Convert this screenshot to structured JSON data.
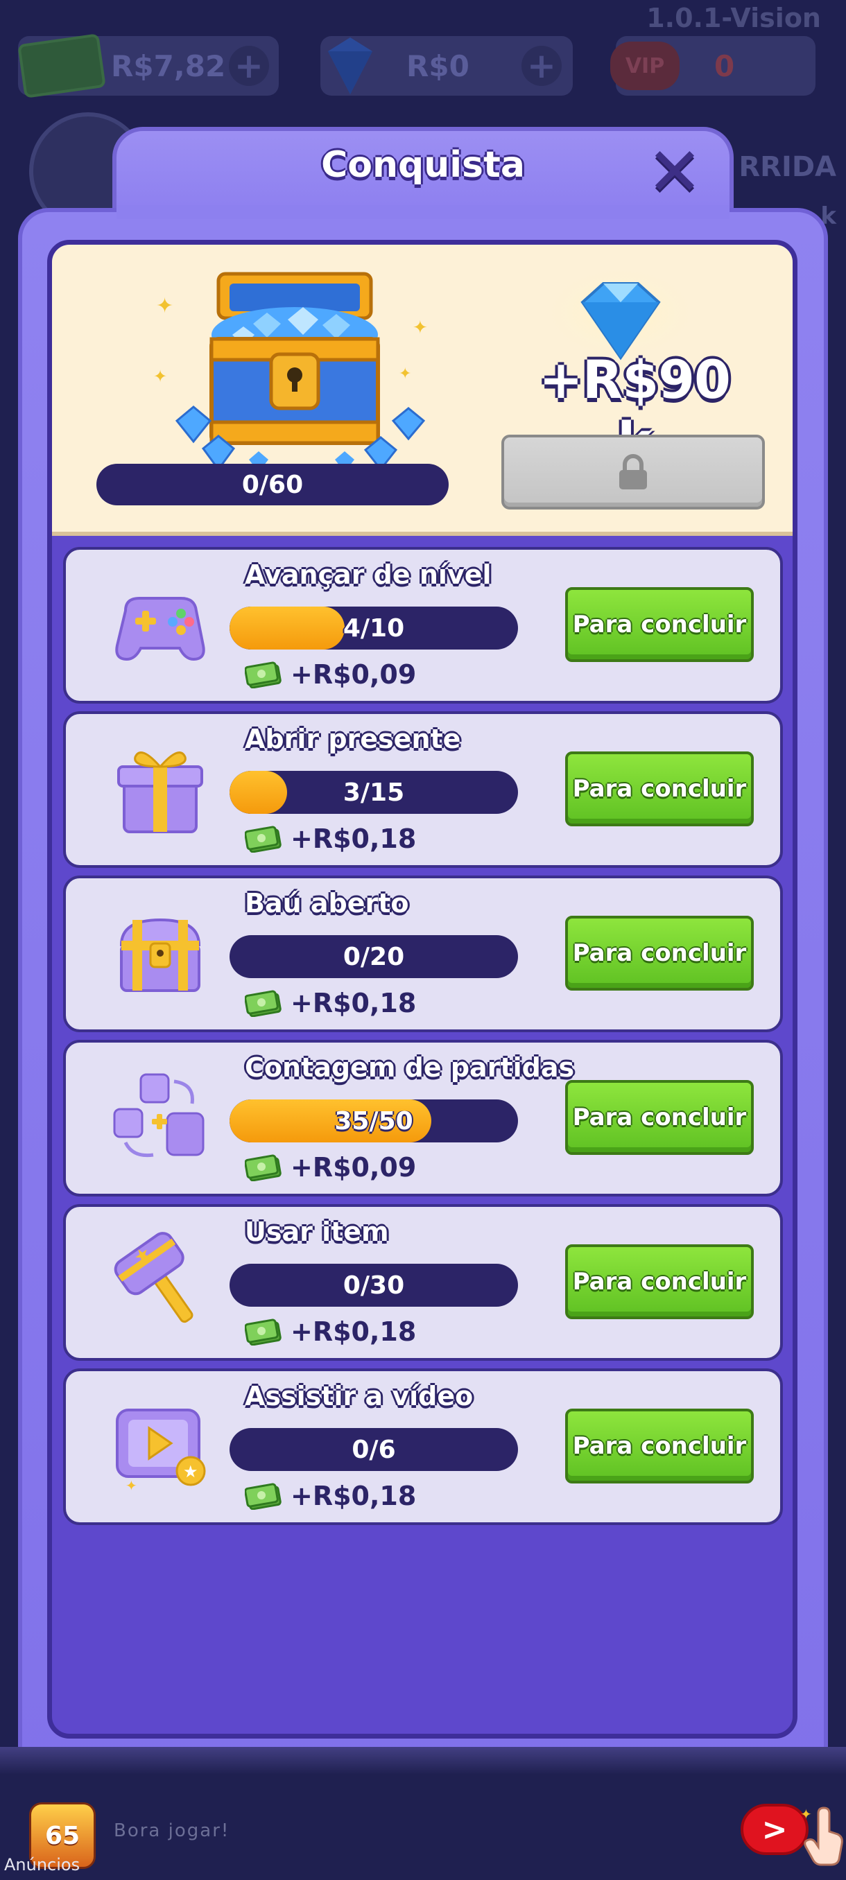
{
  "background": {
    "version": "1.0.1-Vision",
    "balance_cash": "R$7,82",
    "balance_gems": "R$0",
    "vip_label": "VIP",
    "vip_value": "0",
    "side_text_1": "RRIDA",
    "side_text_2": "k"
  },
  "dialog": {
    "title": "Conquista",
    "close_icon": "close-icon",
    "chest": {
      "progress_text": "0/60",
      "progress_fraction": 0.0
    },
    "reward": {
      "amount": "+R$90 k",
      "claim_state": "locked",
      "claim_icon": "lock-icon"
    },
    "tasks": [
      {
        "icon": "gamepad-icon",
        "title": "Avançar de nível",
        "progress": "4/10",
        "fraction": 0.4,
        "reward": "+R$0,09",
        "button": "Para concluir"
      },
      {
        "icon": "gift-icon",
        "title": "Abrir presente",
        "progress": "3/15",
        "fraction": 0.2,
        "reward": "+R$0,18",
        "button": "Para concluir"
      },
      {
        "icon": "treasure-chest-icon",
        "title": "Baú aberto",
        "progress": "0/20",
        "fraction": 0.0,
        "reward": "+R$0,18",
        "button": "Para concluir"
      },
      {
        "icon": "match-count-icon",
        "title": "Contagem de partidas",
        "progress": "35/50",
        "fraction": 0.7,
        "reward": "+R$0,09",
        "button": "Para concluir"
      },
      {
        "icon": "hammer-icon",
        "title": "Usar item",
        "progress": "0/30",
        "fraction": 0.0,
        "reward": "+R$0,18",
        "button": "Para concluir"
      },
      {
        "icon": "video-icon",
        "title": "Assistir a vídeo",
        "progress": "0/6",
        "fraction": 0.0,
        "reward": "+R$0,18",
        "button": "Para concluir"
      }
    ],
    "reward_icon": "cash-icon"
  },
  "ad": {
    "logo_text": "65",
    "text": "Bora jogar!",
    "label": "Anúncios",
    "play_glyph": ">"
  },
  "colors": {
    "accent_green": "#5fc123",
    "progress_orange": "#f59a0c",
    "panel_purple": "#5e48cc",
    "dark_navy": "#2c2467"
  }
}
